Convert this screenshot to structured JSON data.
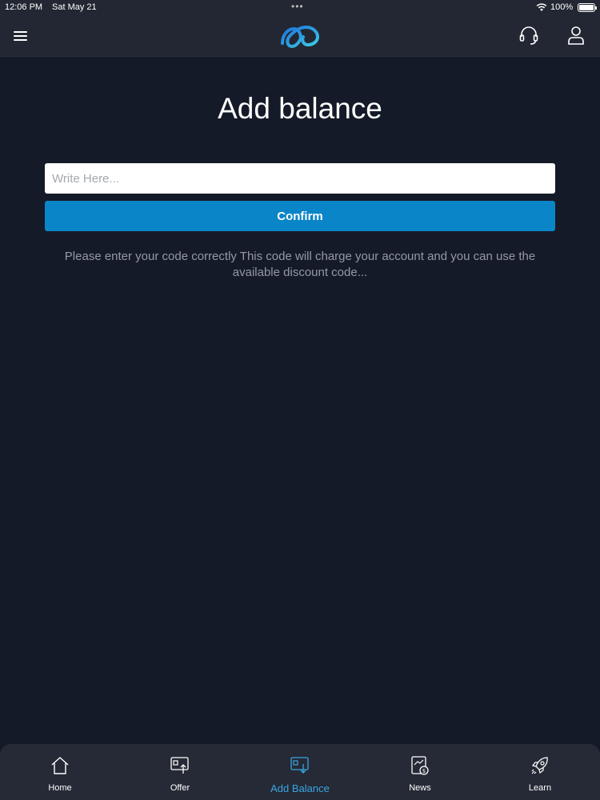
{
  "status_bar": {
    "time": "12:06 PM",
    "date": "Sat May 21",
    "battery": "100%"
  },
  "header": {
    "menu_icon": "hamburger-menu-icon",
    "logo_icon": "infinity-logo-icon",
    "support_icon": "headset-icon",
    "profile_icon": "user-icon"
  },
  "main": {
    "title": "Add balance",
    "input_placeholder": "Write Here...",
    "input_value": "",
    "confirm_label": "Confirm",
    "help_text": "Please enter your code correctly This code will charge your account and you can use the available discount code..."
  },
  "tabs": [
    {
      "label": "Home",
      "icon": "home-icon",
      "active": false
    },
    {
      "label": "Offer",
      "icon": "offer-icon",
      "active": false
    },
    {
      "label": "Add Balance",
      "icon": "add-balance-icon",
      "active": true
    },
    {
      "label": "News",
      "icon": "news-icon",
      "active": false
    },
    {
      "label": "Learn",
      "icon": "rocket-icon",
      "active": false
    }
  ],
  "colors": {
    "background": "#151a28",
    "header": "#222733",
    "accent": "#0a85c8",
    "active_tab": "#3aa4e0"
  }
}
